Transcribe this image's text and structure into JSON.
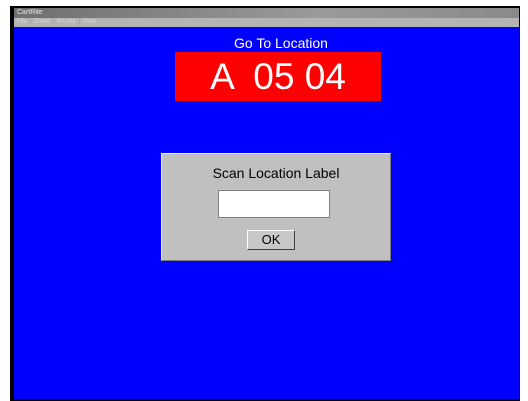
{
  "window": {
    "title": "CartRite"
  },
  "menu": {
    "items": [
      "File",
      "Zoom",
      "Priority",
      "Help"
    ]
  },
  "header": {
    "goto_label": "Go To Location",
    "location": "A  05 04"
  },
  "dialog": {
    "title": "Scan Location Label",
    "input_value": "",
    "ok_label": "OK"
  },
  "colors": {
    "background": "#0000ff",
    "location_box": "#ff0000",
    "dialog": "#c0c0c0"
  }
}
